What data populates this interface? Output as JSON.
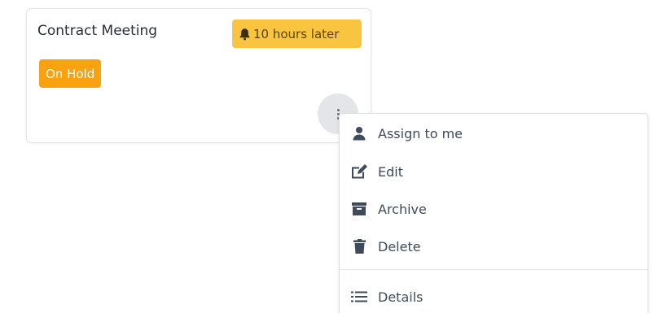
{
  "card": {
    "title": "Contract Meeting",
    "reminder": {
      "icon": "bell-icon",
      "text": "10 hours later",
      "color": "#f9c440"
    },
    "status": {
      "label": "On Hold",
      "color": "#f8a210"
    },
    "menu_button_icon": "kebab-icon"
  },
  "menu": {
    "items": [
      {
        "label": "Assign to me",
        "icon": "user-icon"
      },
      {
        "label": "Edit",
        "icon": "edit-icon"
      },
      {
        "label": "Archive",
        "icon": "archive-icon"
      },
      {
        "label": "Delete",
        "icon": "trash-icon"
      },
      {
        "label": "Details",
        "icon": "list-icon"
      }
    ]
  }
}
